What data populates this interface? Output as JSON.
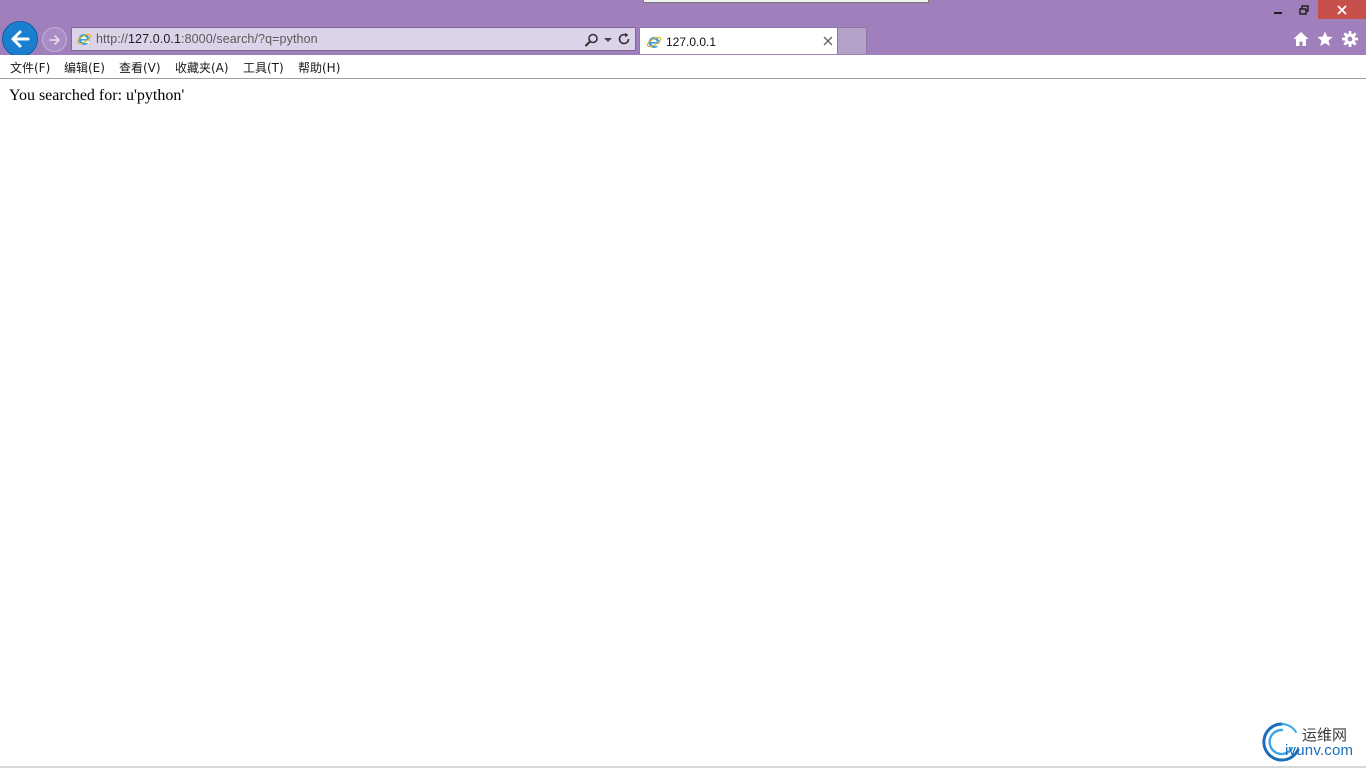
{
  "browser": {
    "address_bar": {
      "url_scheme": "http://",
      "url_host": "127.0.0.1",
      "url_rest": ":8000/search/?q=python"
    },
    "tabs": [
      {
        "title": "127.0.0.1",
        "active": true
      }
    ],
    "icons": {
      "back": "back-arrow-icon",
      "forward": "forward-arrow-icon",
      "site": "ie-page-icon",
      "search": "search-icon",
      "refresh": "refresh-icon",
      "home": "home-icon",
      "favorites": "star-icon",
      "tools": "gear-icon"
    },
    "colors": {
      "frame": "#9f80bd",
      "back_button": "#1a7fd0",
      "close_button": "#c7504b"
    }
  },
  "menu": {
    "items": [
      {
        "label": "文件(F)"
      },
      {
        "label": "编辑(E)"
      },
      {
        "label": "查看(V)"
      },
      {
        "label": "收藏夹(A)"
      },
      {
        "label": "工具(T)"
      },
      {
        "label": "帮助(H)"
      }
    ]
  },
  "page": {
    "body_text": "You searched for: u'python'"
  },
  "watermark": {
    "cn": "运维网",
    "en": "iyunv.com"
  }
}
